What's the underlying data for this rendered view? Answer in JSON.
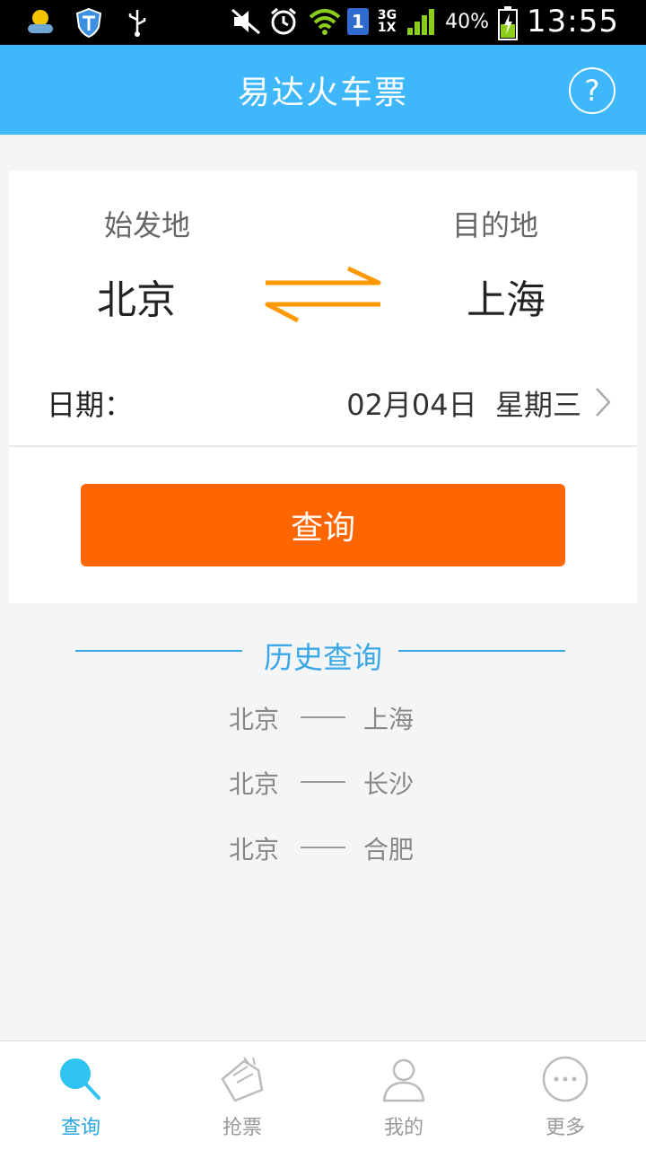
{
  "status_bar": {
    "battery": "40%",
    "time": "13:55",
    "network_type": [
      "3G",
      "1X"
    ],
    "sim": "1"
  },
  "header": {
    "title": "易达火车票",
    "help_label": "?"
  },
  "trip": {
    "from_label": "始发地",
    "to_label": "目的地",
    "from_city": "北京",
    "to_city": "上海",
    "date_label": "日期：",
    "date_value": "02月04日  星期三",
    "search_label": "查询"
  },
  "history": {
    "title": "历史查询",
    "items": [
      {
        "from": "北京",
        "to": "上海"
      },
      {
        "from": "北京",
        "to": "长沙"
      },
      {
        "from": "北京",
        "to": "合肥"
      }
    ]
  },
  "tabs": [
    {
      "label": "查询",
      "icon": "search-icon",
      "active": true
    },
    {
      "label": "抢票",
      "icon": "ticket-icon",
      "active": false
    },
    {
      "label": "我的",
      "icon": "user-icon",
      "active": false
    },
    {
      "label": "更多",
      "icon": "more-icon",
      "active": false
    }
  ],
  "colors": {
    "header": "#3fb8fb",
    "accent": "#ff6600",
    "swap": "#ff9900",
    "history": "#3aa8e8",
    "tab_active": "#2aa6e6"
  }
}
